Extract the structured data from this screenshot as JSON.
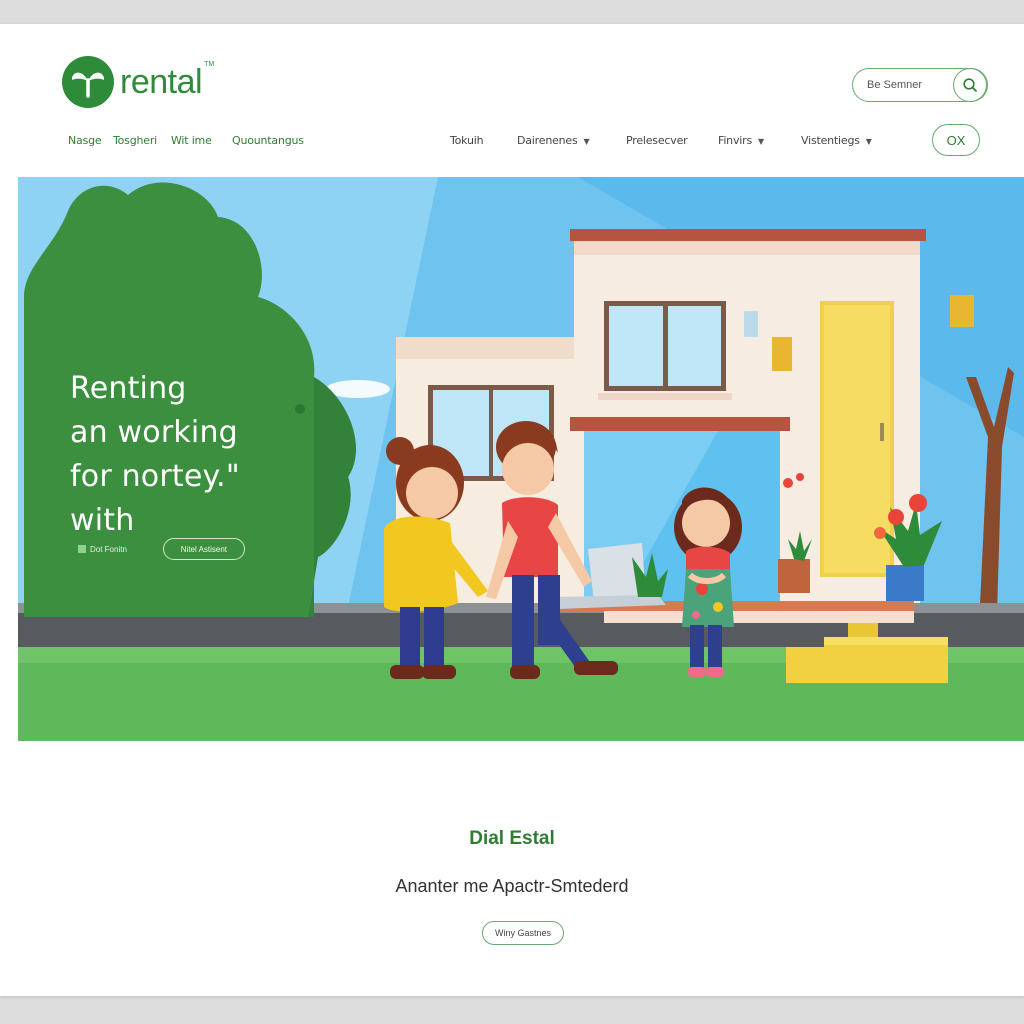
{
  "brand": {
    "name": "rental",
    "tm": "TM"
  },
  "search": {
    "placeholder": "Be Semner"
  },
  "nav": {
    "left": [
      {
        "label": "Nasge"
      },
      {
        "label": "Tosgheri"
      },
      {
        "label": "Wit ime"
      },
      {
        "label": "Quountangus"
      }
    ],
    "right": [
      {
        "label": "Tokuih",
        "dropdown": false
      },
      {
        "label": "Dairenenes",
        "dropdown": true
      },
      {
        "label": "Prelesecver",
        "dropdown": false
      },
      {
        "label": "Finvirs",
        "dropdown": true
      },
      {
        "label": "Vistentiegs",
        "dropdown": true
      }
    ],
    "ok_label": "OX"
  },
  "hero": {
    "lines": [
      "Renting",
      "an working",
      "for nortey.\"",
      "with"
    ],
    "check_label": "Dot Fonitn",
    "button_label": "Nitel Astisent"
  },
  "section": {
    "title": "Dial Estal",
    "subtitle": "Ananter me Apactr-Smtederd",
    "button_label": "Winy Gastnes"
  },
  "colors": {
    "brand_green": "#2e8b3a",
    "hero_green": "#3b8f3e",
    "sky": "#8fd3f4",
    "grass": "#5fb85a"
  },
  "icons": [
    "leaf-logo-icon",
    "search-icon",
    "caret-down-icon"
  ]
}
